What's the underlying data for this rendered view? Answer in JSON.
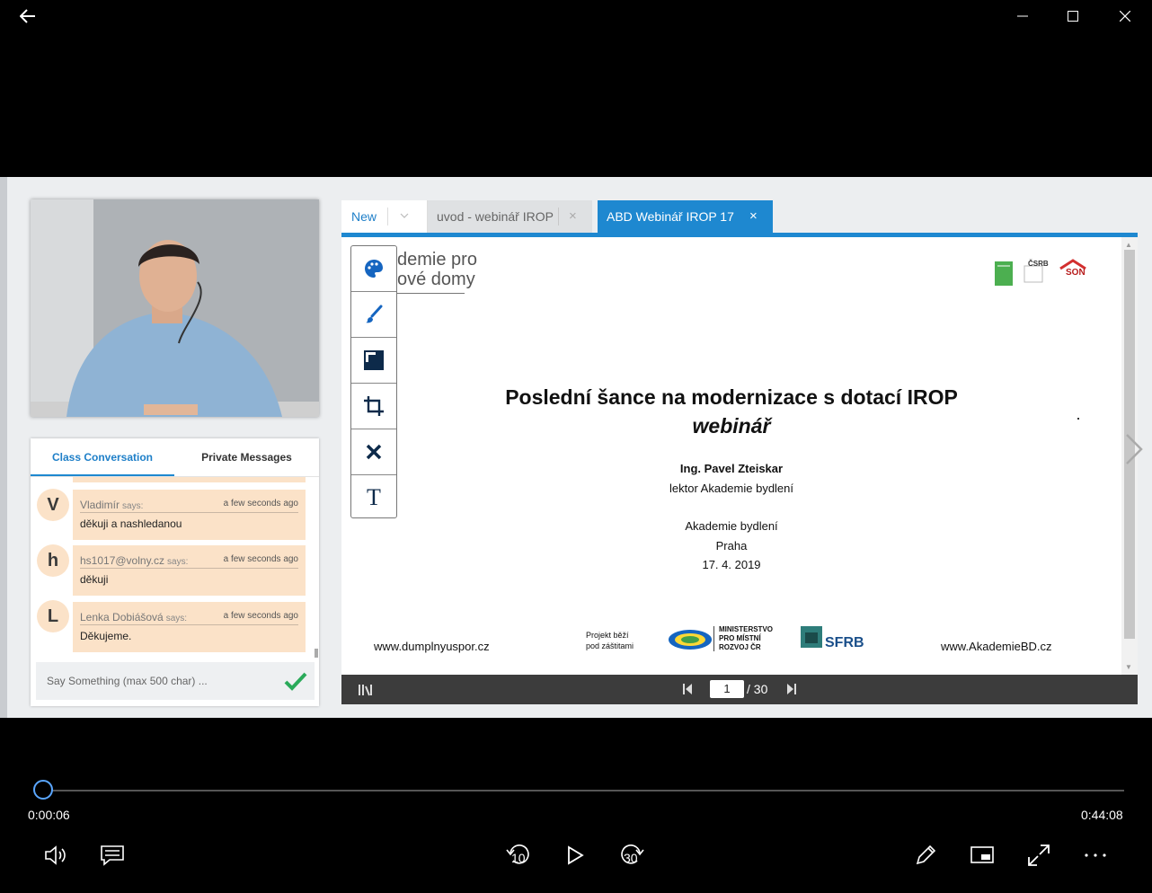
{
  "titlebar": {
    "back": "back",
    "minimize": "minimize",
    "maximize": "maximize",
    "close": "close"
  },
  "chat": {
    "tabs": [
      {
        "label": "Class Conversation",
        "active": true
      },
      {
        "label": "Private Messages",
        "active": false
      }
    ],
    "messages": [
      {
        "initial": "V",
        "name": "Vladimír",
        "says": "says:",
        "time": "a few seconds ago",
        "text": "děkuji a nashledanou"
      },
      {
        "initial": "h",
        "name": "hs1017@volny.cz",
        "says": "says:",
        "time": "a few seconds ago",
        "text": "děkuji"
      },
      {
        "initial": "L",
        "name": "Lenka Dobiášová",
        "says": "says:",
        "time": "a few seconds ago",
        "text": "Děkujeme."
      }
    ],
    "input_placeholder": "Say Something (max 500 char) ..."
  },
  "doc": {
    "tabs": [
      {
        "label": "New"
      },
      {
        "label": "uvod - webinář IROP"
      },
      {
        "label": "ABD Webinář IROP 17"
      }
    ],
    "close_glyph": "×",
    "slide": {
      "logo_line1": "demie pro",
      "logo_line2": "ové domy",
      "title": "Poslední šance na modernizace s dotací IROP",
      "subtitle": "webinář",
      "speaker": "Ing. Pavel Zteiskar",
      "role": "lektor Akademie bydlení",
      "org": "Akademie bydlení",
      "city": "Praha",
      "date": "17. 4. 2019",
      "footer_left": "www.dumplnyuspor.cz",
      "footer_patron_1": "Projekt běží",
      "footer_patron_2": "pod záštitami",
      "ministry_1": "MINISTERSTVO",
      "ministry_2": "PRO MÍSTNÍ",
      "ministry_3": "ROZVOJ ČR",
      "sfrb": "SFRB",
      "footer_right": "www.AkademieBD.cz",
      "csrb": "ČSRB",
      "son": "SON"
    },
    "pager": {
      "current": "1",
      "total": "/ 30"
    },
    "tools": [
      "palette-icon",
      "brush-icon",
      "shapes-icon",
      "crop-icon",
      "clear-icon",
      "text-icon"
    ],
    "text_tool_glyph": "T"
  },
  "player": {
    "elapsed": "0:00:06",
    "duration": "0:44:08",
    "progress_fraction": 0.0023,
    "skip_back": "10",
    "skip_forward": "30"
  },
  "colors": {
    "accent": "#1e88d0",
    "chat_bubble": "#fbe2c8",
    "seek_knob": "#5aa6ff"
  }
}
